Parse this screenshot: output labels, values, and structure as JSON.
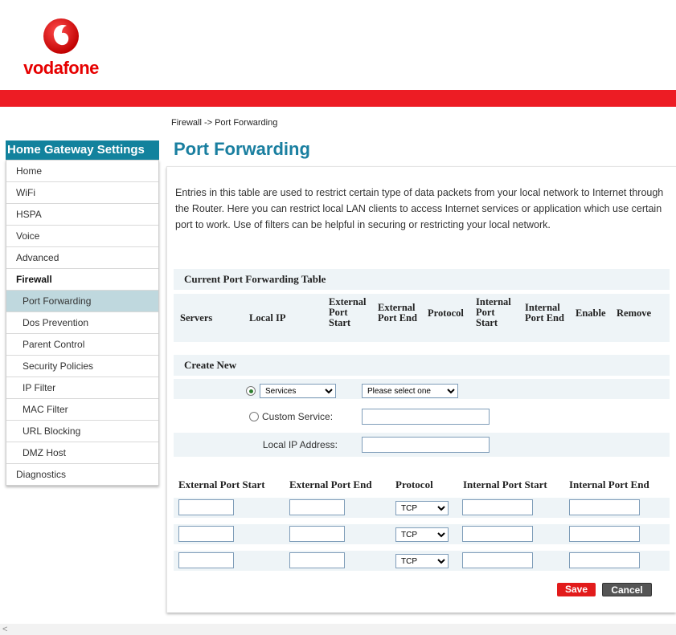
{
  "brand": {
    "name": "vodafone",
    "accent": "#e60000",
    "bar_color": "#ed1c24",
    "teal": "#12829d"
  },
  "breadcrumb": "Firewall -> Port Forwarding",
  "page_title": "Port Forwarding",
  "sidebar": {
    "title": "Home Gateway Settings",
    "items": [
      {
        "label": "Home"
      },
      {
        "label": "WiFi"
      },
      {
        "label": "HSPA"
      },
      {
        "label": "Voice"
      },
      {
        "label": "Advanced"
      },
      {
        "label": "Firewall"
      },
      {
        "label": "Port Forwarding"
      },
      {
        "label": "Dos Prevention"
      },
      {
        "label": "Parent Control"
      },
      {
        "label": "Security Policies"
      },
      {
        "label": "IP Filter"
      },
      {
        "label": "MAC Filter"
      },
      {
        "label": "URL Blocking"
      },
      {
        "label": "DMZ Host"
      },
      {
        "label": "Diagnostics"
      }
    ]
  },
  "description": "Entries in this table are used to restrict certain type of data packets from your local network to Internet through the Router. Here you can restrict local LAN clients to access Internet services or application which use certain port to work. Use of filters can be helpful in securing or restricting your local network.",
  "current_table": {
    "title": "Current Port Forwarding Table",
    "columns": [
      "Servers",
      "Local IP",
      "External Port Start",
      "External Port End",
      "Protocol",
      "Internal Port Start",
      "Internal Port End",
      "Enable",
      "Remove"
    ]
  },
  "create_new": {
    "title": "Create New",
    "services_select": "Services",
    "service_option_select": "Please select one",
    "custom_service_label": "Custom Service:",
    "custom_service_value": "",
    "local_ip_label": "Local IP Address:",
    "local_ip_value": ""
  },
  "ports": {
    "columns": [
      "External Port Start",
      "External Port End",
      "Protocol",
      "Internal Port Start",
      "Internal Port End"
    ],
    "rows": [
      {
        "ext_start": "",
        "ext_end": "",
        "protocol": "TCP",
        "int_start": "",
        "int_end": ""
      },
      {
        "ext_start": "",
        "ext_end": "",
        "protocol": "TCP",
        "int_start": "",
        "int_end": ""
      },
      {
        "ext_start": "",
        "ext_end": "",
        "protocol": "TCP",
        "int_start": "",
        "int_end": ""
      }
    ]
  },
  "buttons": {
    "save": "Save",
    "cancel": "Cancel"
  }
}
